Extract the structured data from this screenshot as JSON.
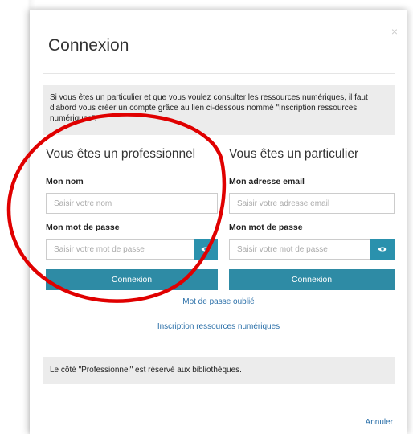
{
  "modal": {
    "title": "Connexion",
    "close_symbol": "×",
    "info_text": "Si vous êtes un particulier et que vous voulez consulter les ressources numériques, il faut d'abord vous créer un compte grâce au lien ci-dessous nommé \"Inscription ressources numériques\".",
    "notice_text": "Le côté \"Professionnel\" est réservé aux bibliothèques.",
    "cancel_label": "Annuler"
  },
  "professional": {
    "heading": "Vous êtes un professionnel",
    "name_label": "Mon nom",
    "name_placeholder": "Saisir votre nom",
    "password_label": "Mon mot de passe",
    "password_placeholder": "Saisir votre mot de passe",
    "submit_label": "Connexion"
  },
  "individual": {
    "heading": "Vous êtes un particulier",
    "email_label": "Mon adresse email",
    "email_placeholder": "Saisir votre adresse email",
    "password_label": "Mon mot de passe",
    "password_placeholder": "Saisir votre mot de passe",
    "submit_label": "Connexion"
  },
  "links": {
    "forgot_password": "Mot de passe oublié",
    "register": "Inscription ressources numériques"
  },
  "icons": {
    "eye": "eye-icon",
    "close": "close-icon"
  },
  "colors": {
    "primary_button": "#2e8ba5",
    "link": "#2a6fa8",
    "annotation_circle": "#e00000"
  }
}
